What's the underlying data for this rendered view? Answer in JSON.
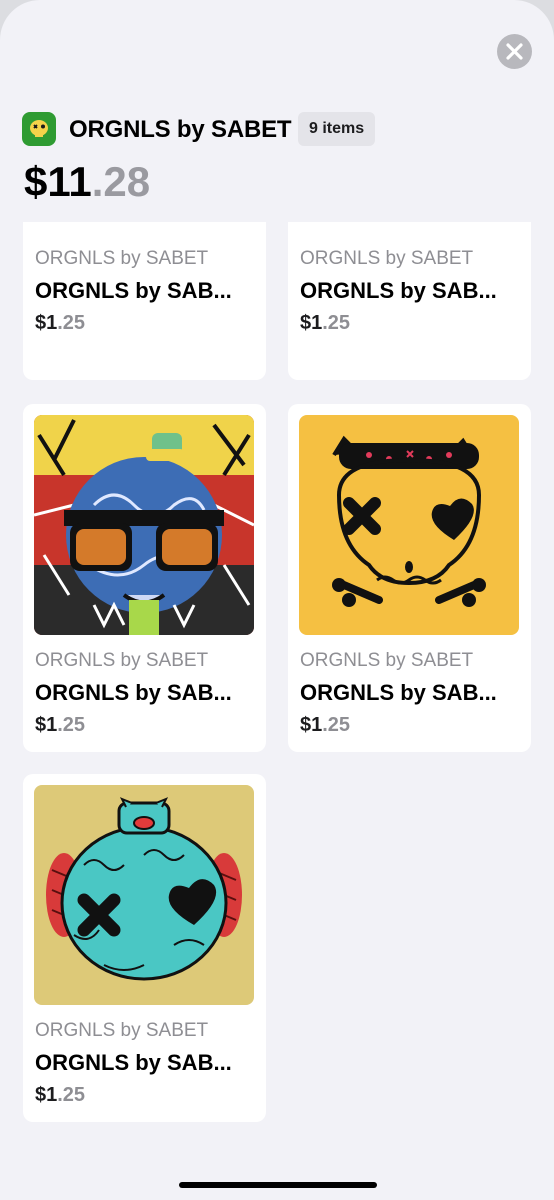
{
  "header": {
    "collection_name": "ORGNLS by SABET",
    "item_count_badge": "9 items",
    "total_price_whole": "$11",
    "total_price_cents": ".28"
  },
  "items": [
    {
      "collection": "ORGNLS by SABET",
      "title": "ORGNLS by SAB...",
      "price_whole": "$1",
      "price_cents": ".25",
      "art_color": "#2e6b2e"
    },
    {
      "collection": "ORGNLS by SABET",
      "title": "ORGNLS by SAB...",
      "price_whole": "$1",
      "price_cents": ".25",
      "art_color": "#d3f7b0"
    },
    {
      "collection": "ORGNLS by SABET",
      "title": "ORGNLS by SAB...",
      "price_whole": "$1",
      "price_cents": ".25",
      "art_color": "#4a7fc1"
    },
    {
      "collection": "ORGNLS by SABET",
      "title": "ORGNLS by SAB...",
      "price_whole": "$1",
      "price_cents": ".25",
      "art_color": "#f5c042"
    },
    {
      "collection": "ORGNLS by SABET",
      "title": "ORGNLS by SAB...",
      "price_whole": "$1",
      "price_cents": ".25",
      "art_color": "#ddc978"
    }
  ],
  "icons": {
    "close": "close-icon",
    "app": "skull-app-icon"
  }
}
